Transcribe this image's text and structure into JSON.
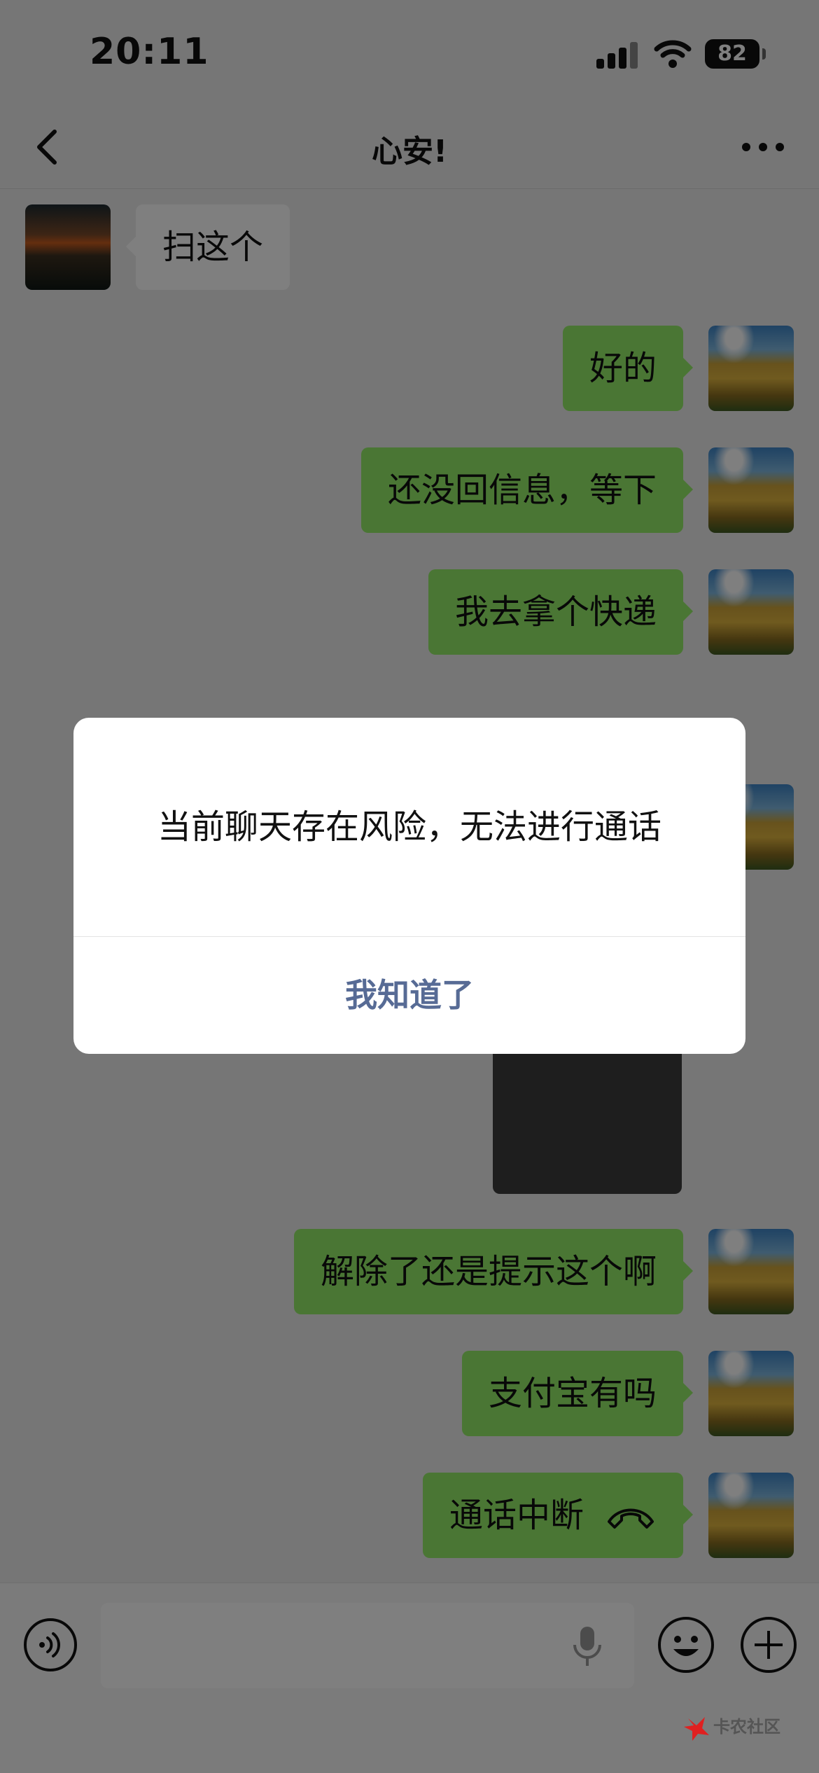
{
  "status_bar": {
    "time": "20:11",
    "battery": "82"
  },
  "header": {
    "title": "心安!"
  },
  "messages": [
    {
      "side": "in",
      "text": "扫这个"
    },
    {
      "side": "out",
      "text": "好的"
    },
    {
      "side": "out",
      "text": "还没回信息，等下"
    },
    {
      "side": "out",
      "text": "我去拿个快递"
    },
    {
      "side": "out",
      "text": "解除了还是提示这个啊"
    },
    {
      "side": "out",
      "text": "支付宝有吗"
    },
    {
      "side": "out",
      "text": "通话中断",
      "icon": "hangup-icon"
    }
  ],
  "dialog": {
    "message": "当前聊天存在风险，无法进行通话",
    "button": "我知道了"
  },
  "input_bar": {
    "value": "",
    "placeholder": ""
  },
  "watermark": {
    "title": "卡农社区"
  },
  "colors": {
    "outgoing_bubble": "#95ec69",
    "incoming_bubble": "#ffffff",
    "dialog_button": "#576b95",
    "background": "#ededed"
  }
}
